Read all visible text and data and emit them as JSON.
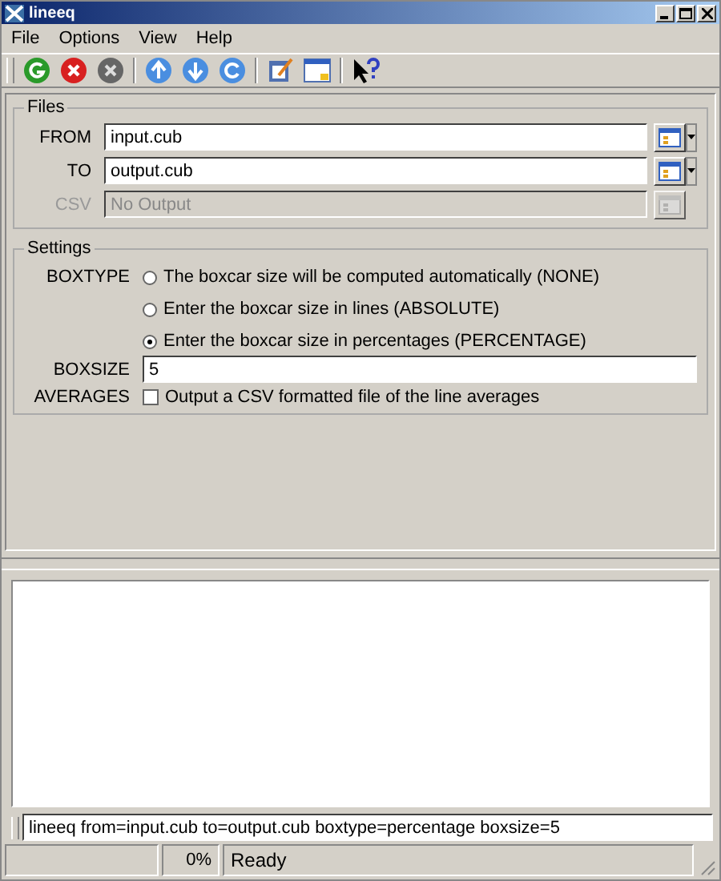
{
  "window": {
    "title": "lineeq"
  },
  "menu": [
    "File",
    "Options",
    "View",
    "Help"
  ],
  "files": {
    "title": "Files",
    "fields": [
      {
        "label": "FROM",
        "value": "input.cub",
        "disabled": false,
        "dropdown": true
      },
      {
        "label": "TO",
        "value": "output.cub",
        "disabled": false,
        "dropdown": true
      },
      {
        "label": "CSV",
        "value": "No Output",
        "disabled": true,
        "dropdown": false
      }
    ]
  },
  "settings": {
    "title": "Settings",
    "boxtype": {
      "label": "BOXTYPE",
      "options": [
        {
          "label": "The boxcar size will be computed automatically (NONE)",
          "selected": false
        },
        {
          "label": "Enter the boxcar size in lines (ABSOLUTE)",
          "selected": false
        },
        {
          "label": "Enter the boxcar size in percentages (PERCENTAGE)",
          "selected": true
        }
      ]
    },
    "boxsize": {
      "label": "BOXSIZE",
      "value": "5"
    },
    "averages": {
      "label": "AVERAGES",
      "text": "Output a CSV formatted file of the line averages",
      "checked": false
    }
  },
  "command_line": "lineeq from=input.cub to=output.cub boxtype=percentage boxsize=5",
  "status_bar": {
    "progress": {
      "level": 0,
      "text": "0%"
    },
    "message": "Ready"
  }
}
